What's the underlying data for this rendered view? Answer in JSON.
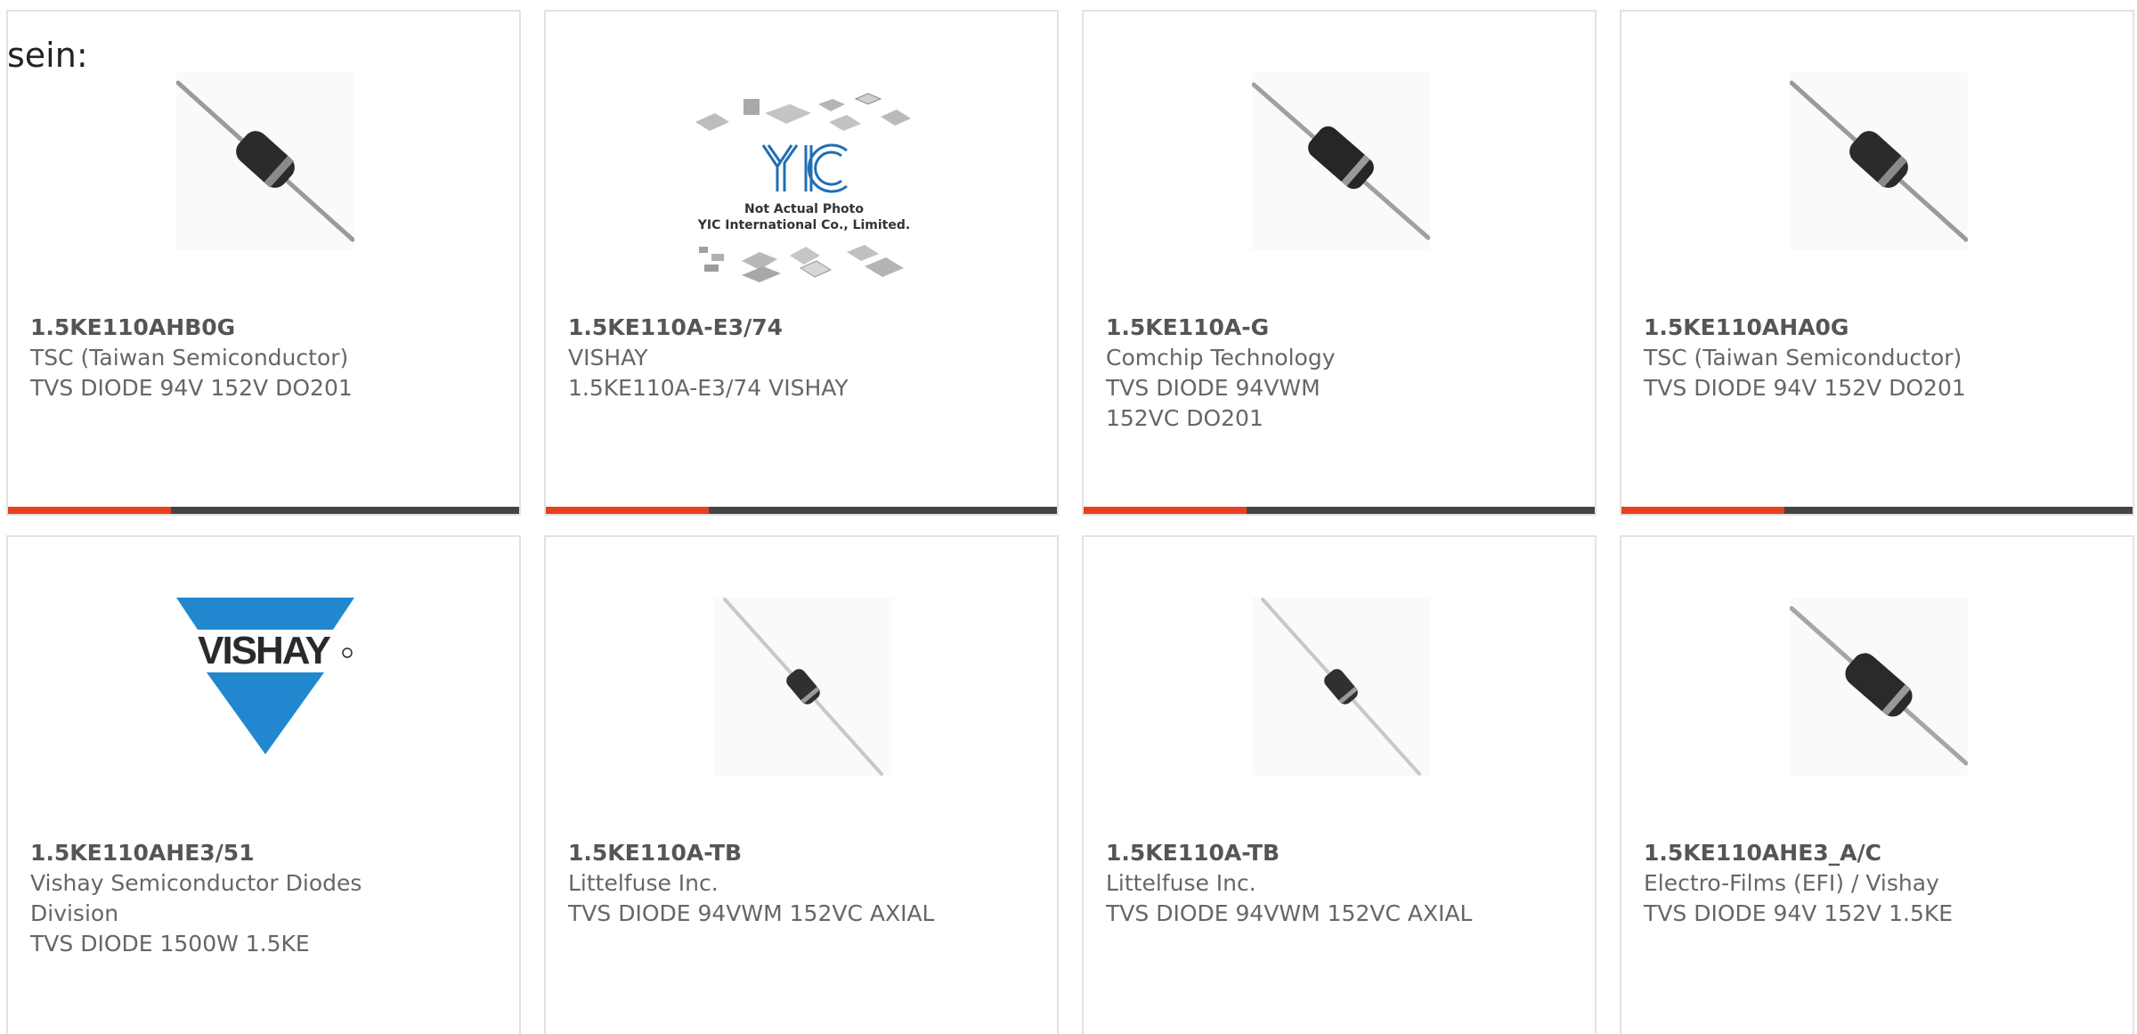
{
  "intro": {
    "text": "sein:"
  },
  "theme": {
    "accent": "#e8401c",
    "bar": "#444444",
    "border": "#e2e2e2",
    "text": "#666666"
  },
  "products": [
    {
      "part_number": "1.5KE110AHB0G",
      "manufacturer": "TSC (Taiwan Semiconductor)",
      "description": "TVS DIODE 94V 152V DO201",
      "image": "axial-diode-icon"
    },
    {
      "part_number": "1.5KE110A-E3/74",
      "manufacturer": "VISHAY",
      "description": "1.5KE110A-E3/74 VISHAY",
      "image": "yic-placeholder-image",
      "image_text": {
        "line1": "Not Actual Photo",
        "line2": "YIC International Co., Limited."
      }
    },
    {
      "part_number": "1.5KE110A-G",
      "manufacturer": "Comchip Technology",
      "description": "TVS DIODE 94VWM 152VC DO201",
      "image": "axial-diode-icon"
    },
    {
      "part_number": "1.5KE110AHA0G",
      "manufacturer": "TSC (Taiwan Semiconductor)",
      "description": "TVS DIODE 94V 152V DO201",
      "image": "axial-diode-icon"
    },
    {
      "part_number": "1.5KE110AHE3/51",
      "manufacturer": "Vishay Semiconductor Diodes Division",
      "description": "TVS DIODE 1500W 1.5KE",
      "image": "vishay-logo"
    },
    {
      "part_number": "1.5KE110A-TB",
      "manufacturer": "Littelfuse Inc.",
      "description": "TVS DIODE 94VWM 152VC AXIAL",
      "image": "small-axial-diode-icon"
    },
    {
      "part_number": "1.5KE110A-TB",
      "manufacturer": "Littelfuse Inc.",
      "description": "TVS DIODE 94VWM 152VC AXIAL",
      "image": "small-axial-diode-icon"
    },
    {
      "part_number": "1.5KE110AHE3_A/C",
      "manufacturer": "Electro-Films (EFI) / Vishay",
      "description": "TVS DIODE 94V 152V 1.5KE",
      "image": "axial-diode-icon"
    }
  ]
}
